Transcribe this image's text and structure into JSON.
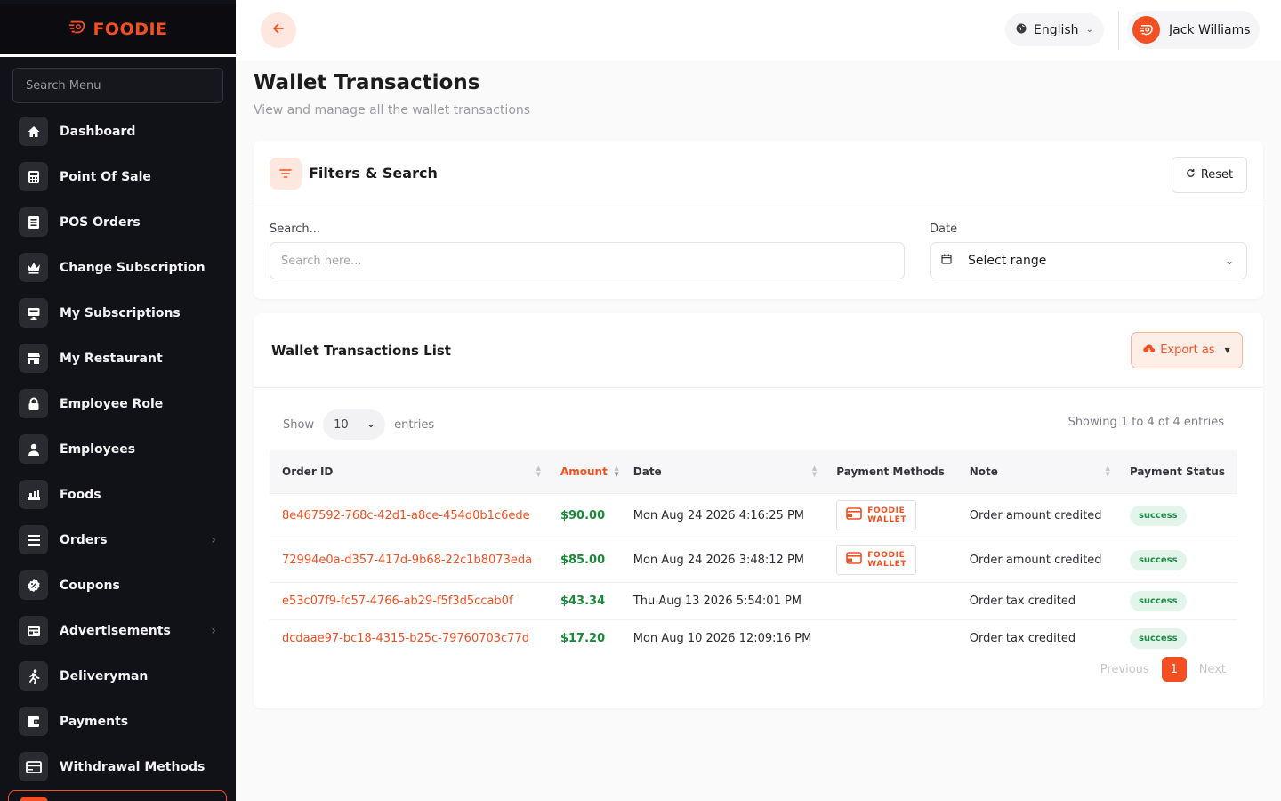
{
  "app": {
    "brand": "FOODIE"
  },
  "sidebar": {
    "search_placeholder": "Search Menu",
    "items": [
      {
        "label": "Dashboard",
        "icon": "home-icon"
      },
      {
        "label": "Point Of Sale",
        "icon": "calculator-icon"
      },
      {
        "label": "POS Orders",
        "icon": "list-icon"
      },
      {
        "label": "Change Subscription",
        "icon": "crown-icon"
      },
      {
        "label": "My Subscriptions",
        "icon": "monitor-icon"
      },
      {
        "label": "My Restaurant",
        "icon": "store-icon"
      },
      {
        "label": "Employee Role",
        "icon": "lock-icon"
      },
      {
        "label": "Employees",
        "icon": "user-icon"
      },
      {
        "label": "Foods",
        "icon": "food-icon"
      },
      {
        "label": "Orders",
        "icon": "orders-icon"
      },
      {
        "label": "Coupons",
        "icon": "coupon-icon"
      },
      {
        "label": "Advertisements",
        "icon": "ad-icon"
      },
      {
        "label": "Deliveryman",
        "icon": "runner-icon"
      },
      {
        "label": "Payments",
        "icon": "wallet-icon"
      },
      {
        "label": "Withdrawal Methods",
        "icon": "card-icon"
      }
    ]
  },
  "topbar": {
    "language": "English",
    "user_name": "Jack Williams"
  },
  "page": {
    "title": "Wallet Transactions",
    "subtitle": "View and manage all the wallet transactions"
  },
  "filters": {
    "title": "Filters & Search",
    "reset_label": "Reset",
    "search_label": "Search...",
    "search_placeholder": "Search here...",
    "date_label": "Date",
    "date_value": "Select range"
  },
  "list": {
    "title": "Wallet Transactions List",
    "export_label": "Export as",
    "show_label": "Show",
    "entries_value": "10",
    "entries_label": "entries",
    "showing_text": "Showing 1 to 4 of 4 entries",
    "columns": [
      "Order ID",
      "Amount",
      "Date",
      "Payment Methods",
      "Note",
      "Payment Status"
    ],
    "rows": [
      {
        "order_id": "8e467592-768c-42d1-a8ce-454d0b1c6ede",
        "amount": "$90.00",
        "date": "Mon Aug 24 2026 4:16:25 PM",
        "method": "FOODIE WALLET",
        "note": "Order amount credited",
        "status": "success"
      },
      {
        "order_id": "72994e0a-d357-417d-9b68-22c1b8073eda",
        "amount": "$85.00",
        "date": "Mon Aug 24 2026 3:48:12 PM",
        "method": "FOODIE WALLET",
        "note": "Order amount credited",
        "status": "success"
      },
      {
        "order_id": "e53c07f9-fc57-4766-ab29-f5f3d5ccab0f",
        "amount": "$43.34",
        "date": "Thu Aug 13 2026 5:54:01 PM",
        "method": "",
        "note": "Order tax credited",
        "status": "success"
      },
      {
        "order_id": "dcdaae97-bc18-4315-b25c-79760703c77d",
        "amount": "$17.20",
        "date": "Mon Aug 10 2026 12:09:16 PM",
        "method": "",
        "note": "Order tax credited",
        "status": "success"
      }
    ],
    "pager": {
      "previous": "Previous",
      "current": "1",
      "next": "Next"
    }
  },
  "colors": {
    "accent": "#f25022",
    "sidebar_bg": "#111217",
    "success": "#1f8a48",
    "amount": "#1a8a3a"
  }
}
